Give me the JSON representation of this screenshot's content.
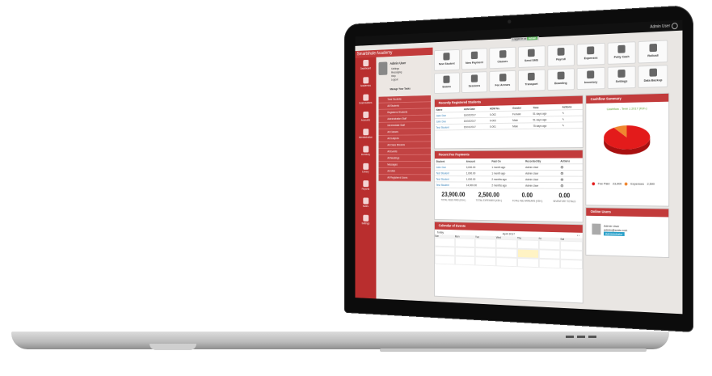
{
  "topbar": {
    "user": "Admin User",
    "progress_label": "Logged in as",
    "progress_value": "Admin"
  },
  "brand": "Smartshule Academy",
  "nav": [
    "Dashboard",
    "Academics",
    "Examinations",
    "Accounts",
    "Administration",
    "Inventory",
    "Library",
    "Reports",
    "Notes",
    "Settings"
  ],
  "profile": {
    "name": "Admin User",
    "menu": [
      "Settings",
      "Messaging",
      "Help",
      "Logout"
    ],
    "manage": "Manage Your Tasks"
  },
  "submenu": [
    "Total Students",
    "All Students",
    "Registered Students",
    "Administration Staff",
    "Intermediate Staff",
    "All Classes",
    "All Subjects",
    "All Class Streams",
    "All Events",
    "All Meetings",
    "Messages",
    "All SMS",
    "All Registered Users"
  ],
  "tiles": [
    "New Student",
    "New Payment",
    "Classes",
    "Send SMS",
    "Payroll",
    "Expenses",
    "Petty Cash",
    "Rollcall",
    "Exams",
    "Sessions",
    "Fee Arrears",
    "Transport",
    "Boarding",
    "Inventory",
    "Settings",
    "Data Backup"
  ],
  "students": {
    "title": "Recently Registered Students",
    "headers": [
      "Name",
      "ADM Date",
      "ADM No.",
      "Gender",
      "Time",
      "Actions"
    ],
    "rows": [
      [
        "Jane Doe",
        "16/02/2017",
        "0-002",
        "Female",
        "51 days ago"
      ],
      [
        "John Doe",
        "15/02/2017",
        "0-003",
        "Male",
        "51 days ago"
      ],
      [
        "Test Student",
        "15/01/2017",
        "0-001",
        "Male",
        "75 days ago"
      ]
    ]
  },
  "payments": {
    "title": "Recent Fee Payments",
    "headers": [
      "Student",
      "Amount",
      "Paid On",
      "Recorded By",
      "Actions"
    ],
    "rows": [
      [
        "John Doe",
        "3,000.00",
        "1 month ago",
        "Admin User"
      ],
      [
        "Test Student",
        "1,000.00",
        "1 month ago",
        "Admin User"
      ],
      [
        "Test Student",
        "1,000.00",
        "2 months ago",
        "Admin User"
      ],
      [
        "Test Student",
        "14,000.00",
        "2 months ago",
        "Admin User"
      ]
    ],
    "totals": [
      {
        "value": "23,900.00",
        "label": "TOTAL FEES PAID (KSH.)"
      },
      {
        "value": "2,500.00",
        "label": "TOTAL EXPENSES (KSH.)"
      },
      {
        "value": "0.00",
        "label": "TOTAL FEE ARREARS (KSH.)"
      },
      {
        "value": "0.00",
        "label": "INVENTORY TOTALS"
      }
    ]
  },
  "calendar": {
    "title": "Calendar of Events",
    "month": "April 2017",
    "view": "today",
    "days": [
      "Sun",
      "Mon",
      "Tue",
      "Wed",
      "Thu",
      "Fri",
      "Sat"
    ]
  },
  "cashflow": {
    "title": "Cashflow Summary",
    "subtitle": "Cashflow - Term 1 2017 (Ksh.)",
    "legend": [
      {
        "label": "Fee Paid",
        "value": "23,900",
        "color": "#e31b1b"
      },
      {
        "label": "Expenses",
        "value": "2,500",
        "color": "#f0862f"
      }
    ]
  },
  "online": {
    "title": "Online Users",
    "name": "Admin User",
    "email": "admin@smis.com",
    "role": "Administrator"
  },
  "chart_data": {
    "type": "pie",
    "title": "Cashflow - Term 1 2017 (Ksh.)",
    "labels": [
      "Fee Paid",
      "Expenses"
    ],
    "values": [
      23900,
      2500
    ],
    "colors": [
      "#e31b1b",
      "#f0862f"
    ]
  }
}
